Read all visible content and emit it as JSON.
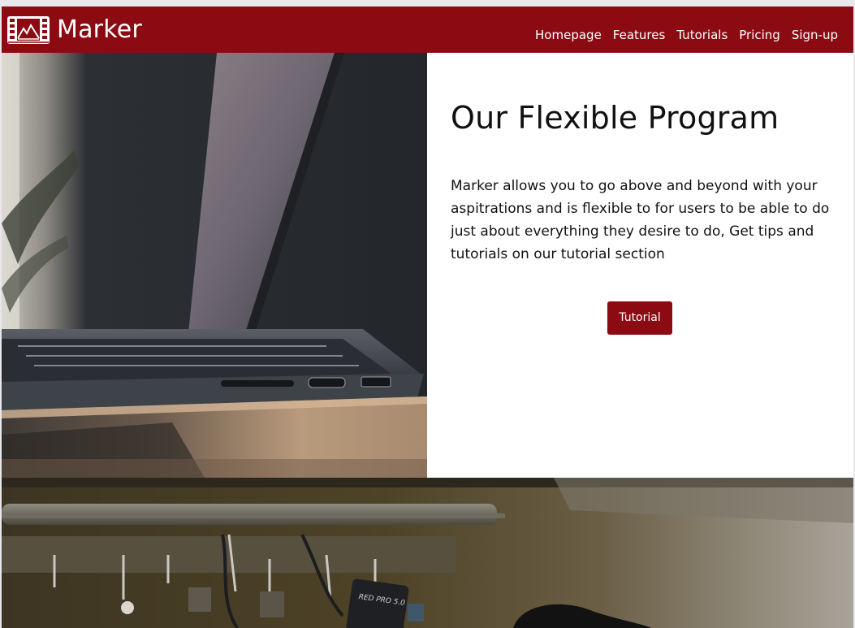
{
  "brand": {
    "name": "Marker",
    "logo_icon": "film-strip-mountain-icon"
  },
  "nav": {
    "links": [
      {
        "label": "Homepage"
      },
      {
        "label": "Features"
      },
      {
        "label": "Tutorials"
      },
      {
        "label": "Pricing"
      },
      {
        "label": "Sign-up"
      }
    ]
  },
  "hero": {
    "title": "Our Flexible Program",
    "body": "Marker allows you to go above and beyond with your aspitrations and is flexible to for users to be able to do just about everything they desire to do, Get tips and tutorials on our tutorial section",
    "button_label": "Tutorial",
    "image": "laptop-on-desk-photo"
  },
  "second_section": {
    "image": "studio-camera-rig-photo",
    "camera_label": "RED PRO 5.0"
  },
  "colors": {
    "brand": "#8c0a12",
    "text": "#111111",
    "background": "#ffffff"
  }
}
